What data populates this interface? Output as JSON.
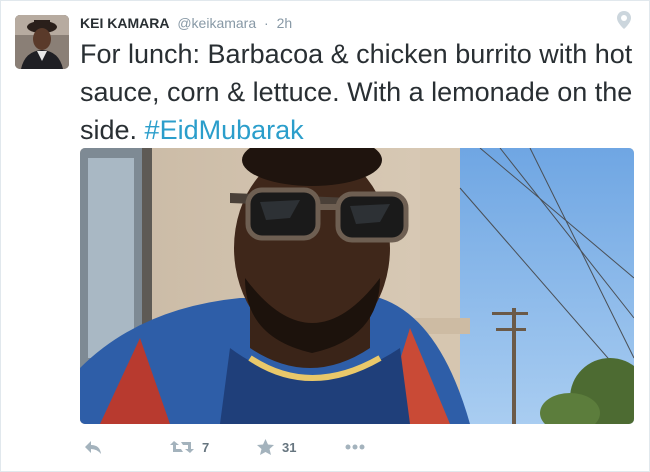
{
  "tweet": {
    "author_name": "KEI KAMARA",
    "author_handle": "@keikamara",
    "separator": "·",
    "timestamp": "2h",
    "text_main": "For lunch: Barbacoa & chicken burrito with hot sauce, corn & lettuce. With a lemonade on the side. ",
    "hashtag": "#EidMubarak"
  },
  "actions": {
    "reply_icon": "reply-icon",
    "retweet_icon": "retweet-icon",
    "retweet_count": "7",
    "favorite_icon": "star-icon",
    "favorite_count": "31",
    "more_icon": "more-icon"
  },
  "icons": {
    "geo": "location-pin-icon"
  },
  "colors": {
    "hashtag": "#2b9ecb",
    "text": "#292f33",
    "muted": "#8899a6",
    "action_icon": "#a4b3bd"
  }
}
